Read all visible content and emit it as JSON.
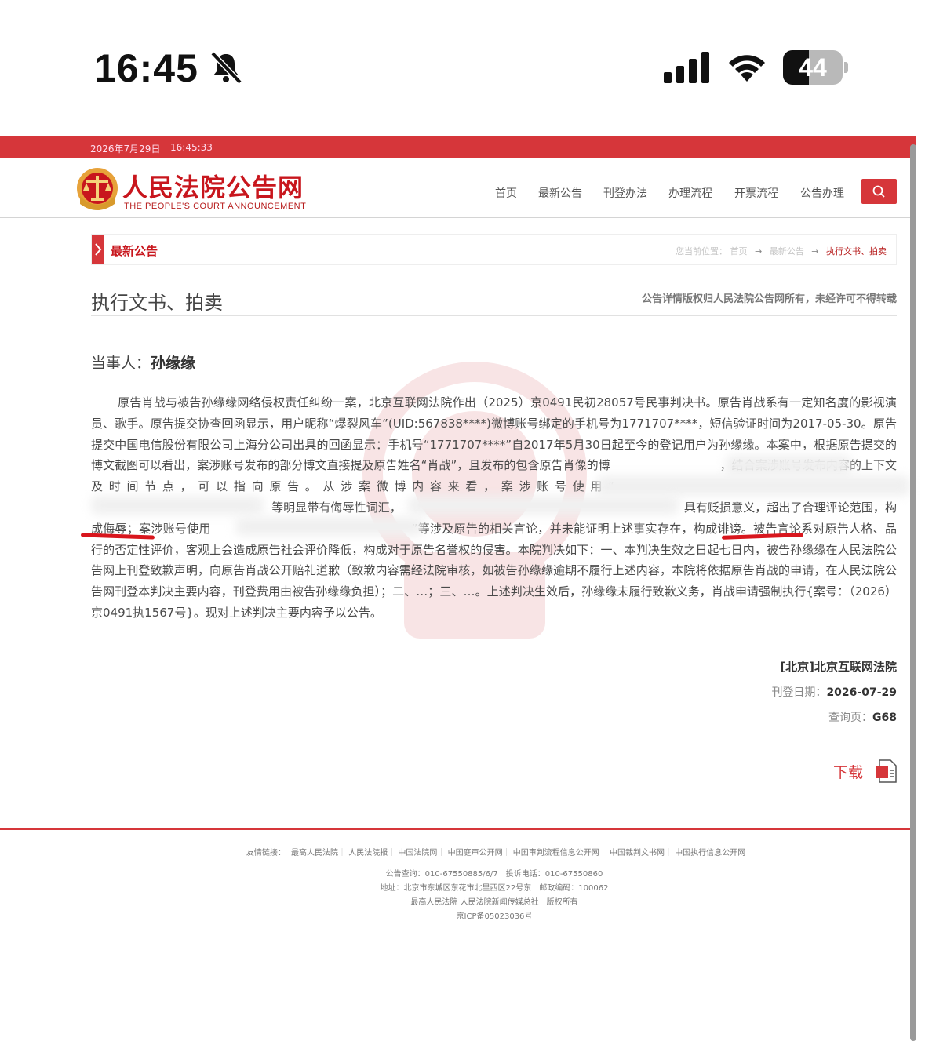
{
  "status_bar": {
    "time": "16:45",
    "battery_level": "44",
    "battery_fraction": 0.44
  },
  "site": {
    "topbar_date": "2026年7月29日",
    "topbar_time": "16:45:33",
    "logo_cn": "人民法院公告网",
    "logo_en": "THE PEOPLE'S COURT ANNOUNCEMENT",
    "nav": [
      "首页",
      "最新公告",
      "刊登办法",
      "办理流程",
      "开票流程",
      "公告办理"
    ],
    "accent": "#d6363a"
  },
  "breadcrumb": {
    "section": "最新公告",
    "prefix": "您当前位置：",
    "items": [
      "首页",
      "→",
      "最新公告",
      "→",
      "执行文书、拍卖"
    ]
  },
  "doc": {
    "title": "执行文书、拍卖",
    "copyright": "公告详情版权归人民法院公告网所有，未经许可不得转载",
    "party_label": "当事人：",
    "party_name": "孙缘缘",
    "body_parts": [
      "原告肖战与被告孙缘缘网络侵权责任纠纷一案，北京互联网法院作出（2025）京0491民初28057号民事判决书。原告肖战系有一定知名度的影视演员、歌手。原告提交协查回函显示，用户昵称“爆裂风车”(UID:567838****)微博账号绑定的手机号为1771707****，短信验证时间为2017-05-30。原告提交中国电信股份有限公司上海分公司出具的回函显示：手机号“1771707****”自2017年5月30日起至今的登记用户为孙缘缘。本案中，根据原告提交的博文截图可以看出，案涉账号发布的部分博文直接提及原告姓名“肖战”，且发布的包含原告肖像的博",
      "，结合案涉账号发布内容的上下文及时间节点，可以指向原告。从涉案微博内容来看，案涉账号使用“",
      "等明显带有侮辱性词汇，",
      "具有贬损意义，超出了合理评论范围，",
      "构成侮辱；",
      "案涉账号使用",
      "”等涉及原告的相关言论，并未能证明上述事实存在，",
      "构成诽谤。",
      "被告言论系对原告人格、品行的否定性评价，客观上会造成原告社会评价降低，构成对于原告名誉权的侵害。本院判决如下：一、本判决生效之日起七日内，被告孙缘缘在人民法院公告网上刊登致歉声明，向原告肖战公开赔礼道歉（致歉内容需经法院审核，如被告孙缘缘逾期不履行上述内容，本院将依据原告肖战的申请，在人民法院公告网刊登本判决主要内容，刊登费用由被告孙缘缘负担）；二、…；三、…。上述判决生效后，孙缘缘未履行致歉义务，肖战申请强制执行{案号：（2026）京0491执1567号}。现对上述判决主要内容予以公告。"
    ],
    "court": "[北京]北京互联网法院",
    "pub_date_label": "刊登日期：",
    "pub_date": "2026-07-29",
    "query_page_label": "查询页：",
    "query_page": "G68",
    "download": "下载"
  },
  "footer": {
    "links_label": "友情链接：",
    "links": [
      "最高人民法院",
      "人民法院报",
      "中国法院网",
      "中国庭审公开网",
      "中国审判流程信息公开网",
      "中国裁判文书网",
      "中国执行信息公开网"
    ],
    "line1": "公告查询：010-67550885/6/7　投诉电话：010-67550860",
    "line2": "地址：北京市东城区东花市北里西区22号东　邮政编码：100062",
    "line3": "最高人民法院 人民法院新闻传媒总社　版权所有",
    "line4": "京ICP备05023036号"
  }
}
